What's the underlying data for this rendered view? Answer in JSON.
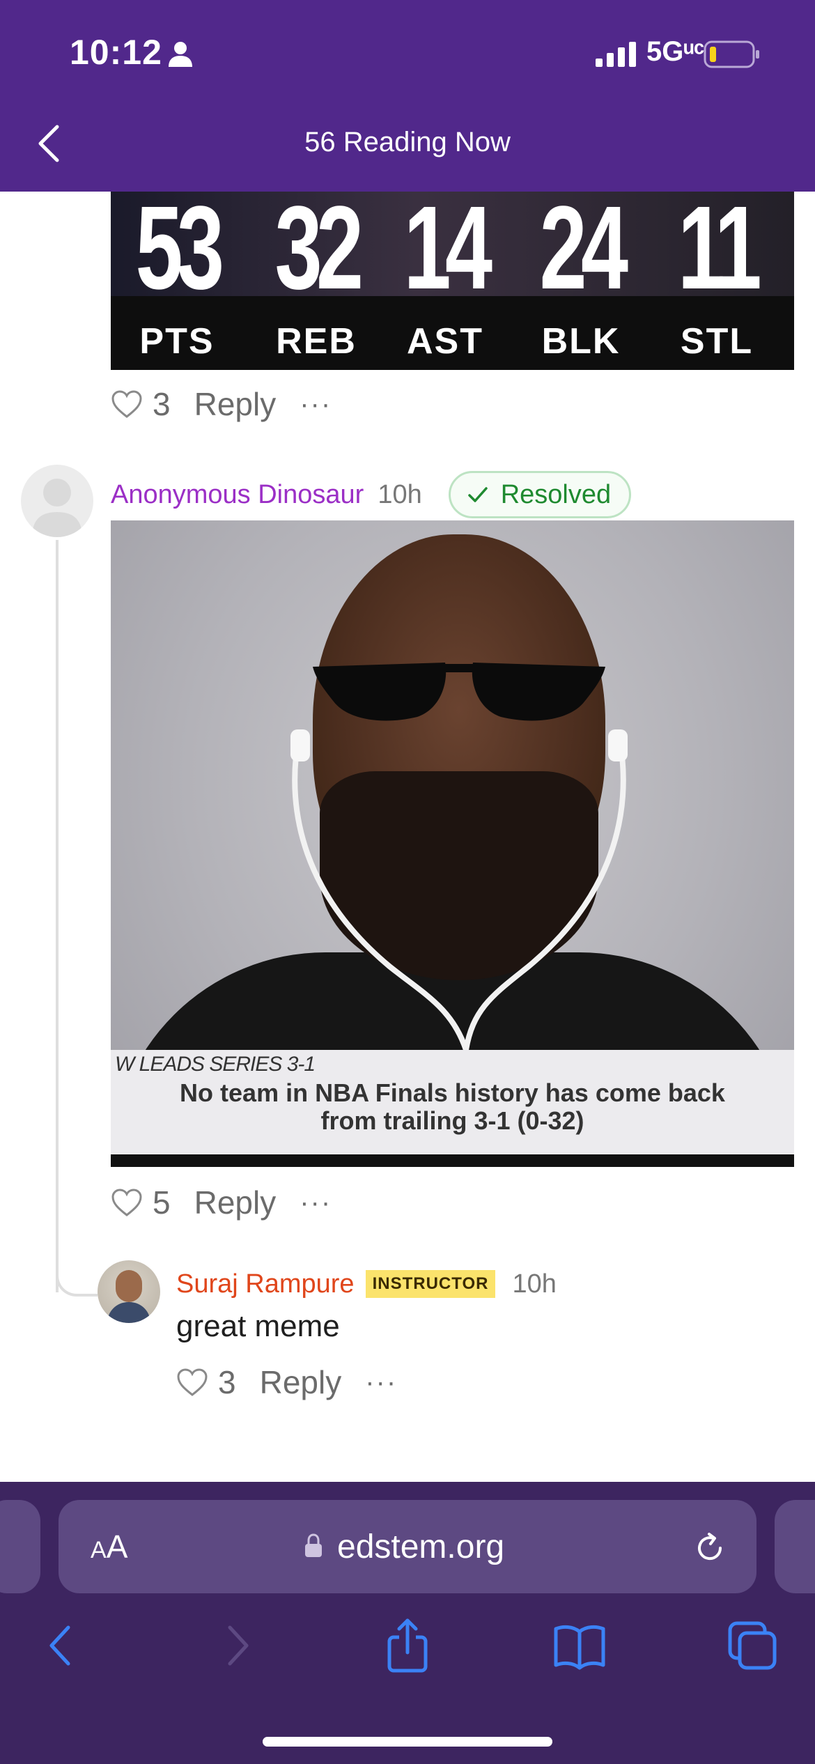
{
  "status_bar": {
    "time": "10:12",
    "network": "5Gᵘᶜ"
  },
  "header": {
    "title": "56 Reading Now"
  },
  "stats_card": {
    "stats": [
      {
        "value": "53",
        "label": "PTS"
      },
      {
        "value": "32",
        "label": "REB"
      },
      {
        "value": "14",
        "label": "AST"
      },
      {
        "value": "24",
        "label": "BLK"
      },
      {
        "value": "11",
        "label": "STL"
      }
    ],
    "likes": "3",
    "reply_label": "Reply",
    "more": "···"
  },
  "comment": {
    "author": "Anonymous Dinosaur",
    "time": "10h",
    "status": "Resolved",
    "meme_small_caption": "W LEADS SERIES 3-1",
    "meme_caption_line1": "No team in NBA Finals history has come back",
    "meme_caption_line2": "from trailing 3-1 (0-32)",
    "likes": "5",
    "reply_label": "Reply",
    "more": "···"
  },
  "reply": {
    "author": "Suraj Rampure",
    "role": "INSTRUCTOR",
    "time": "10h",
    "text": "great meme",
    "likes": "3",
    "reply_label": "Reply",
    "more": "···"
  },
  "browser": {
    "aa_small": "A",
    "aa_large": "A",
    "url": "edstem.org"
  },
  "colors": {
    "header_bg": "#51288b",
    "anon_author": "#9b2fc6",
    "instructor_author": "#e0461b",
    "resolved": "#1f8a30",
    "badge_bg": "#fbe36c",
    "browser_bg": "#3d2560",
    "ios_blue": "#3b82f6"
  }
}
